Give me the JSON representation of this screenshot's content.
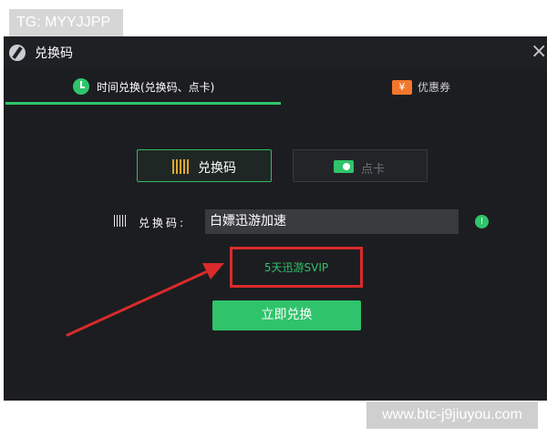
{
  "watermarks": {
    "top_left": "TG: MYYJJPP",
    "bottom_right": "www.btc-j9jiuyou.com"
  },
  "dialog": {
    "title": "兑换码",
    "close_glyph": "×"
  },
  "tabs": [
    {
      "label": "时间兑换(兑换码、点卡)",
      "icon": "clock-icon",
      "active": true
    },
    {
      "label": "优惠券",
      "icon": "ticket-icon",
      "active": false
    }
  ],
  "coupon_icon_glyph": "¥",
  "modes": [
    {
      "label": "兑换码",
      "icon": "barcode-icon",
      "selected": true
    },
    {
      "label": "点卡",
      "icon": "card-icon",
      "selected": false
    }
  ],
  "form": {
    "code_label": "兑换码:",
    "code_value": "白嫖迅游加速",
    "info_glyph": "!"
  },
  "result": {
    "text": "5天迅游SVIP"
  },
  "actions": {
    "redeem_label": "立即兑换"
  },
  "colors": {
    "accent_green": "#2fc46b",
    "highlight_red": "#d92b2b",
    "dialog_background": "#1c1d20",
    "coupon_orange": "#f2772b",
    "barcode_gold": "#e3a62f"
  }
}
